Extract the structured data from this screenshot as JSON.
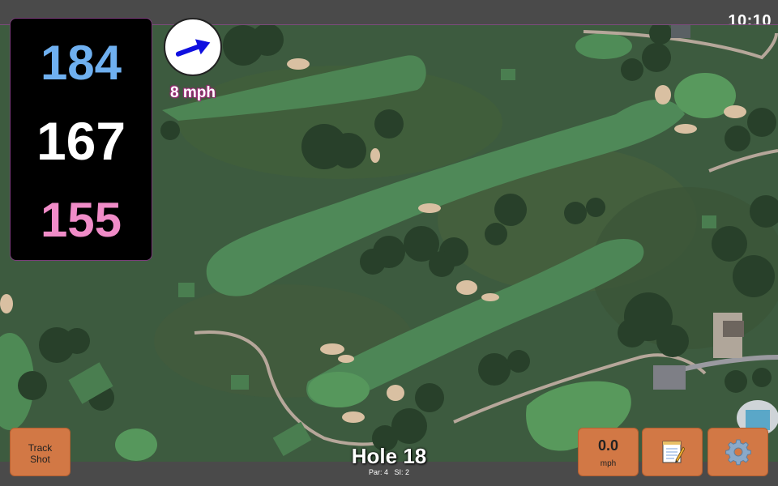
{
  "clock": "10:10",
  "yardage": {
    "back": "184",
    "middle": "167",
    "front": "155"
  },
  "wind": {
    "speed_text": "8 mph",
    "icon": "wind-direction-arrow-icon"
  },
  "buttons": {
    "track_shot_line1": "Track",
    "track_shot_line2": "Shot",
    "speed_value": "0.0",
    "speed_unit": "mph",
    "notes_icon": "notepad-icon",
    "settings_icon": "gear-icon"
  },
  "hole": {
    "title": "Hole 18",
    "par": "Par: 4",
    "si": "SI: 2"
  },
  "colors": {
    "back_yardage": "#6fb0f0",
    "middle_yardage": "#ffffff",
    "front_yardage": "#f08cc8",
    "button_bg": "#d27845",
    "wind_arrow": "#1010e0"
  }
}
